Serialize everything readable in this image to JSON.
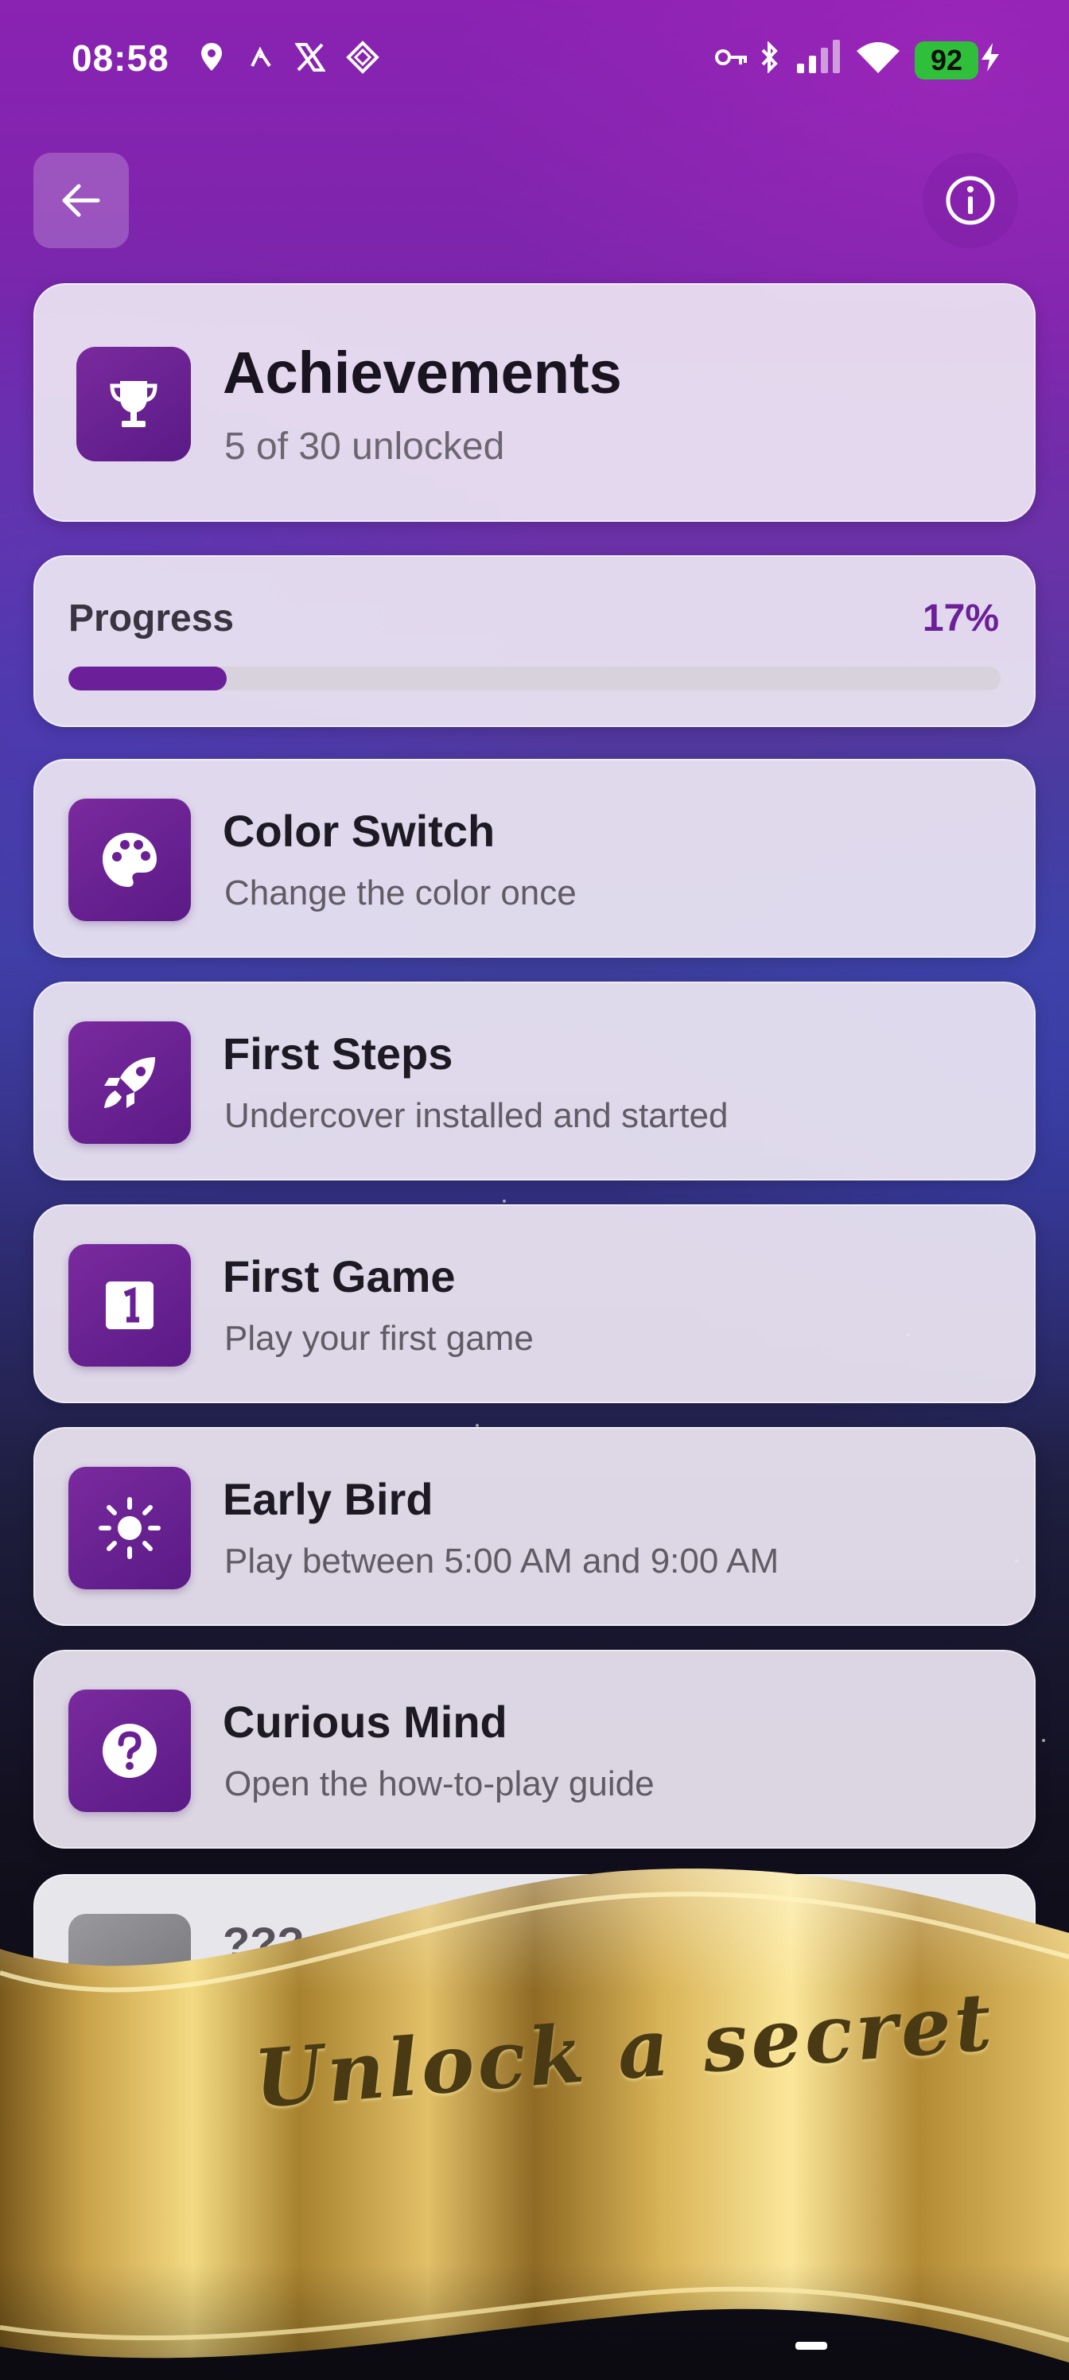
{
  "status_bar": {
    "time": "08:58",
    "battery": "92",
    "left_icons": [
      "location-icon",
      "app-a-icon",
      "x-icon",
      "diamond-icon"
    ],
    "right_icons": [
      "key-icon",
      "bluetooth-icon",
      "signal-icon",
      "wifi-icon",
      "battery-icon",
      "charging-icon"
    ]
  },
  "toolbar": {
    "back_icon": "arrow-left-icon",
    "info_icon": "info-icon"
  },
  "header": {
    "title": "Achievements",
    "subtitle": "5 of 30 unlocked",
    "icon": "trophy-icon"
  },
  "progress": {
    "label": "Progress",
    "percent_text": "17%",
    "value": 0.17
  },
  "achievements": [
    {
      "title": "Color Switch",
      "description": "Change the color once",
      "icon": "palette-icon"
    },
    {
      "title": "First Steps",
      "description": "Undercover installed and started",
      "icon": "rocket-icon"
    },
    {
      "title": "First Game",
      "description": "Play your first game",
      "icon": "number-one-icon"
    },
    {
      "title": "Early Bird",
      "description": "Play between 5:00 AM and 9:00 AM",
      "icon": "sun-icon"
    },
    {
      "title": "Curious Mind",
      "description": "Open the how-to-play guide",
      "icon": "question-icon"
    }
  ],
  "locked_achievement": {
    "title": "???",
    "icon": "lock-icon"
  },
  "banner": {
    "text": "Unlock a secret"
  },
  "colors": {
    "accent": "#6b1f98",
    "card": "#ece5f2",
    "gold": "#d4b04a"
  }
}
